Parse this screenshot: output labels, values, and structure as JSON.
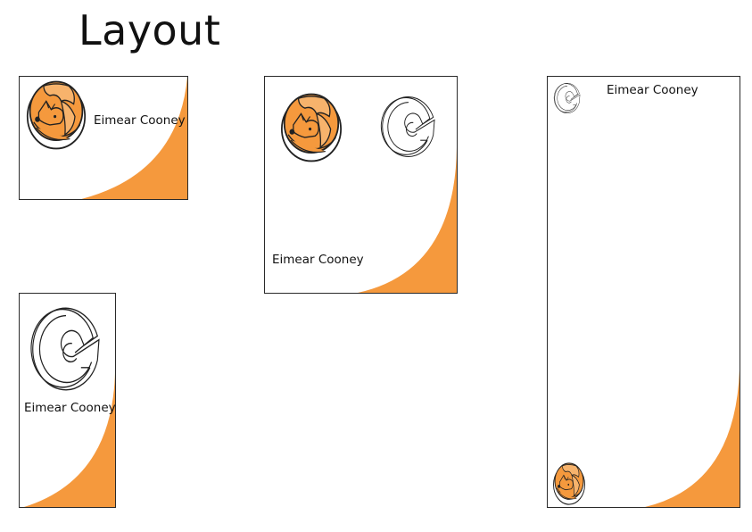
{
  "page": {
    "title": "Layout"
  },
  "colors": {
    "accent": "#f5993d",
    "accent_light": "#f7b36c",
    "outline": "#222222"
  },
  "cards": [
    {
      "name_text": "Eimear Cooney",
      "emblem": "fox-logo"
    },
    {
      "name_text": "Eimear Cooney",
      "emblem": "fox-logo-and-c-monogram"
    },
    {
      "name_text": "Eimear Cooney",
      "emblem": "c-monogram-and-fox-logo"
    },
    {
      "name_text": "Eimear Cooney",
      "emblem": "c-monogram"
    }
  ]
}
